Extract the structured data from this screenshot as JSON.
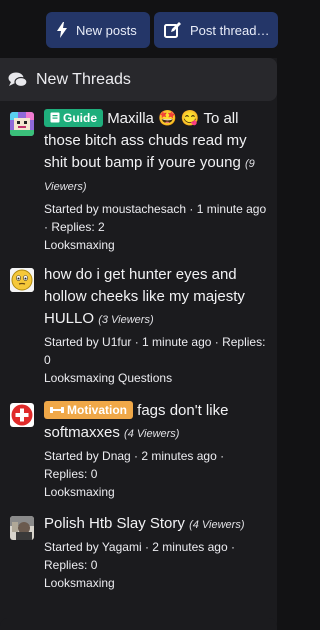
{
  "toolbar": {
    "new_posts_label": "New posts",
    "post_thread_label": "Post thread…"
  },
  "widget": {
    "title": "New Threads",
    "icon": "comments-icon"
  },
  "threads": [
    {
      "prefix": "Guide",
      "title": "Maxilla 🤩 😋 To all those bitch ass chuds read my shit bout bamp if youre young",
      "viewers": "(9 Viewers)",
      "meta": "Started by moustachesach · 1 minute ago · Replies: 2",
      "forum": "Looksmaxing",
      "avatar": "pixel-avatar"
    },
    {
      "prefix": "",
      "title": "how do i get hunter eyes and hollow cheeks like my majesty HULLO",
      "viewers": "(3 Viewers)",
      "meta": "Started by U1fur · 1 minute ago · Replies: 0",
      "forum": "Looksmaxing Questions",
      "avatar": "emoji-face-avatar"
    },
    {
      "prefix": "Motivation",
      "title": "fags don't like softmaxxes",
      "viewers": "(4 Viewers)",
      "meta": "Started by Dnag · 2 minutes ago · Replies: 0",
      "forum": "Looksmaxing",
      "avatar": "red-cross-avatar"
    },
    {
      "prefix": "",
      "title": "Polish Htb Slay Story",
      "viewers": "(4 Viewers)",
      "meta": "Started by Yagami · 2 minutes ago · Replies: 0",
      "forum": "Looksmaxing",
      "avatar": "photo-avatar"
    }
  ],
  "colors": {
    "background": "#121214",
    "panel": "#1b1b1e",
    "button": "#243668",
    "guide_prefix": "#1fae7c",
    "motivation_prefix": "#f0a848"
  }
}
